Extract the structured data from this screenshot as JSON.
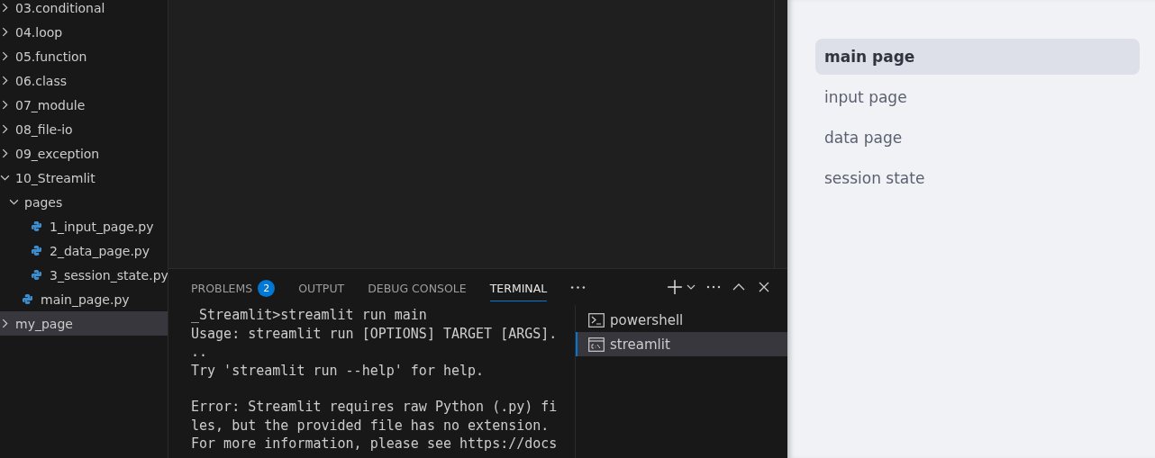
{
  "explorer": {
    "items": [
      {
        "name": "03.conditional",
        "kind": "folder",
        "expanded": false,
        "selected": false
      },
      {
        "name": "04.loop",
        "kind": "folder",
        "expanded": false,
        "selected": false
      },
      {
        "name": "05.function",
        "kind": "folder",
        "expanded": false,
        "selected": false
      },
      {
        "name": "06.class",
        "kind": "folder",
        "expanded": false,
        "selected": false
      },
      {
        "name": "07_module",
        "kind": "folder",
        "expanded": false,
        "selected": false
      },
      {
        "name": "08_file-io",
        "kind": "folder",
        "expanded": false,
        "selected": false
      },
      {
        "name": "09_exception",
        "kind": "folder",
        "expanded": false,
        "selected": false
      },
      {
        "name": "10_Streamlit",
        "kind": "folder",
        "expanded": true,
        "selected": false,
        "children": [
          {
            "name": "pages",
            "kind": "folder",
            "expanded": true,
            "selected": false,
            "children": [
              {
                "name": "1_input_page.py",
                "kind": "python",
                "selected": false
              },
              {
                "name": "2_data_page.py",
                "kind": "python",
                "selected": false
              },
              {
                "name": "3_session_state.py",
                "kind": "python",
                "selected": false
              }
            ]
          },
          {
            "name": "main_page.py",
            "kind": "python",
            "selected": false
          }
        ]
      },
      {
        "name": "my_page",
        "kind": "folder",
        "expanded": false,
        "selected": true
      }
    ]
  },
  "panel": {
    "tabs": [
      {
        "label": "PROBLEMS",
        "badge": "2",
        "selected": false
      },
      {
        "label": "OUTPUT",
        "selected": false
      },
      {
        "label": "DEBUG CONSOLE",
        "selected": false
      },
      {
        "label": "TERMINAL",
        "selected": true
      }
    ],
    "terminal_blocks": [
      [
        "_Streamlit>streamlit run main",
        "Usage: streamlit run [OPTIONS] TARGET [ARGS].",
        "..",
        "Try 'streamlit run --help' for help."
      ],
      [
        "Error: Streamlit requires raw Python (.py) fi",
        "les, but the provided file has no extension.",
        "For more information, please see https://docs"
      ]
    ],
    "terminals": [
      {
        "name": "powershell",
        "kind": "powershell",
        "selected": false
      },
      {
        "name": "streamlit",
        "kind": "cmd",
        "selected": true
      }
    ]
  },
  "app_nav": [
    {
      "label": "main page",
      "selected": true
    },
    {
      "label": "input page",
      "selected": false
    },
    {
      "label": "data page",
      "selected": false
    },
    {
      "label": "session state",
      "selected": false
    }
  ]
}
